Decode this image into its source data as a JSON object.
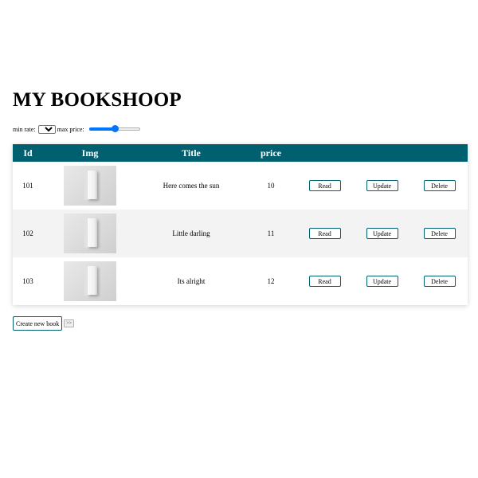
{
  "page": {
    "title": "MY BOOKSHOOP"
  },
  "filters": {
    "min_rate_label": "min rate:",
    "min_rate_value": "0",
    "max_price_label": "max price:",
    "max_price_level": 0.5
  },
  "table": {
    "headers": {
      "id": "Id",
      "img": "Img",
      "title": "Title",
      "price": "price"
    },
    "header_color": "#006070",
    "rows": [
      {
        "id": "101",
        "title": "Here comes the sun",
        "price": "10",
        "read": "Read",
        "update": "Update",
        "delete": "Delete"
      },
      {
        "id": "102",
        "title": "Little darling",
        "price": "11",
        "read": "Read",
        "update": "Update",
        "delete": "Delete"
      },
      {
        "id": "103",
        "title": "Its alright",
        "price": "12",
        "read": "Read",
        "update": "Update",
        "delete": "Delete"
      }
    ]
  },
  "actions": {
    "create_label": "Create new book",
    "next_label": ">>"
  }
}
